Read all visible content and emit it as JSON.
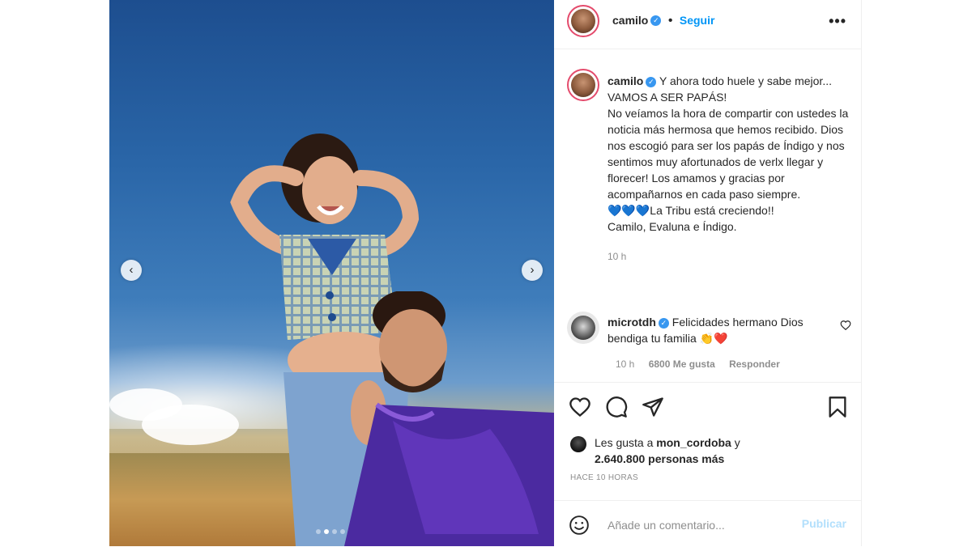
{
  "header": {
    "username": "camilo",
    "follow_label": "Seguir",
    "more_label": "•••"
  },
  "caption": {
    "username": "camilo",
    "lines": [
      "Y ahora todo huele y sabe mejor...",
      "VAMOS A SER PAPÁS!",
      "No veíamos la hora de compartir con ustedes la noticia más hermosa que hemos recibido. Dios nos escogió para ser los papás de Índigo y nos sentimos muy afortunados de verlx llegar y florecer! Los amamos y gracias por acompañarnos en cada paso siempre.",
      "💙💙💙La Tribu está creciendo!!",
      "Camilo, Evaluna e Índigo."
    ],
    "time": "10 h"
  },
  "comment": {
    "username": "microtdh",
    "text": "Felicidades hermano Dios bendiga tu familia 👏❤️",
    "time": "10 h",
    "likes": "6800 Me gusta",
    "reply_label": "Responder"
  },
  "likes": {
    "prefix": "Les gusta a ",
    "user": "mon_cordoba",
    "connector": " y",
    "count": "2.640.800 personas más"
  },
  "posted": "HACE 10 HORAS",
  "add_comment": {
    "placeholder": "Añade un comentario...",
    "publish_label": "Publicar"
  },
  "carousel": {
    "prev_label": "‹",
    "next_label": "›",
    "slide_count": 4,
    "active_slide": 2
  },
  "colors": {
    "follow": "#0095f6",
    "verified": "#3897f0",
    "publish_disabled": "#b2dffc",
    "story_ring": "#e44b6c"
  }
}
